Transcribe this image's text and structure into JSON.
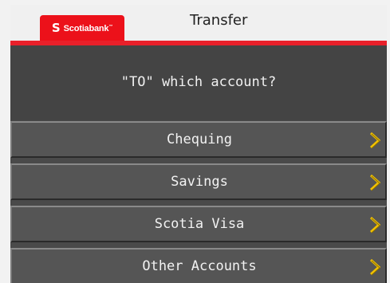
{
  "header": {
    "logo_mark": "S",
    "logo_text": "Scotiabank",
    "logo_tm": "™",
    "title": "Transfer"
  },
  "prompt": "\"TO\" which account?",
  "options": [
    {
      "label": "Chequing",
      "icon": "chevron-right-icon"
    },
    {
      "label": "Savings",
      "icon": "chevron-right-icon"
    },
    {
      "label": "Scotia Visa",
      "icon": "chevron-right-icon"
    },
    {
      "label": "Other Accounts",
      "icon": "chevron-right-icon"
    }
  ],
  "colors": {
    "brand_red": "#ec111a",
    "screen_bg": "#4a4a4a",
    "button_bg": "#555555",
    "arrow": "#f2c200"
  }
}
